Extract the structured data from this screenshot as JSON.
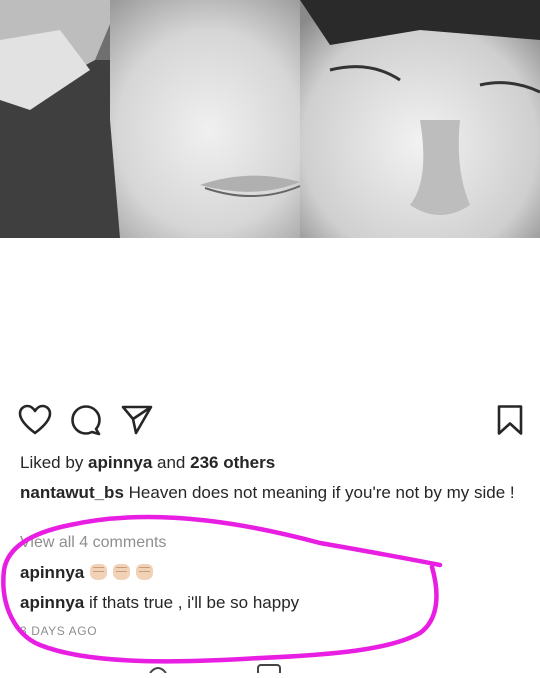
{
  "post": {
    "likes": {
      "prefix": "Liked by ",
      "user": "apinnya",
      "middle": " and ",
      "count": "236 others"
    },
    "caption": {
      "username": "nantawut_bs",
      "text": " Heaven does not meaning if you're not by my side !"
    },
    "view_all_comments": "View all 4 comments",
    "comments": [
      {
        "username": "apinnya",
        "emoji": "👏🏻👏🏻👏🏻"
      },
      {
        "username": "apinnya",
        "text": " if thats true , i'll be so happy"
      }
    ],
    "timestamp": "3 DAYS AGO"
  },
  "icons": {
    "like": "heart-icon",
    "comment": "comment-bubble-icon",
    "share": "paper-plane-icon",
    "save": "bookmark-icon"
  },
  "colors": {
    "text": "#262626",
    "muted": "#8e8e8e",
    "annotation": "#e91ee3"
  }
}
